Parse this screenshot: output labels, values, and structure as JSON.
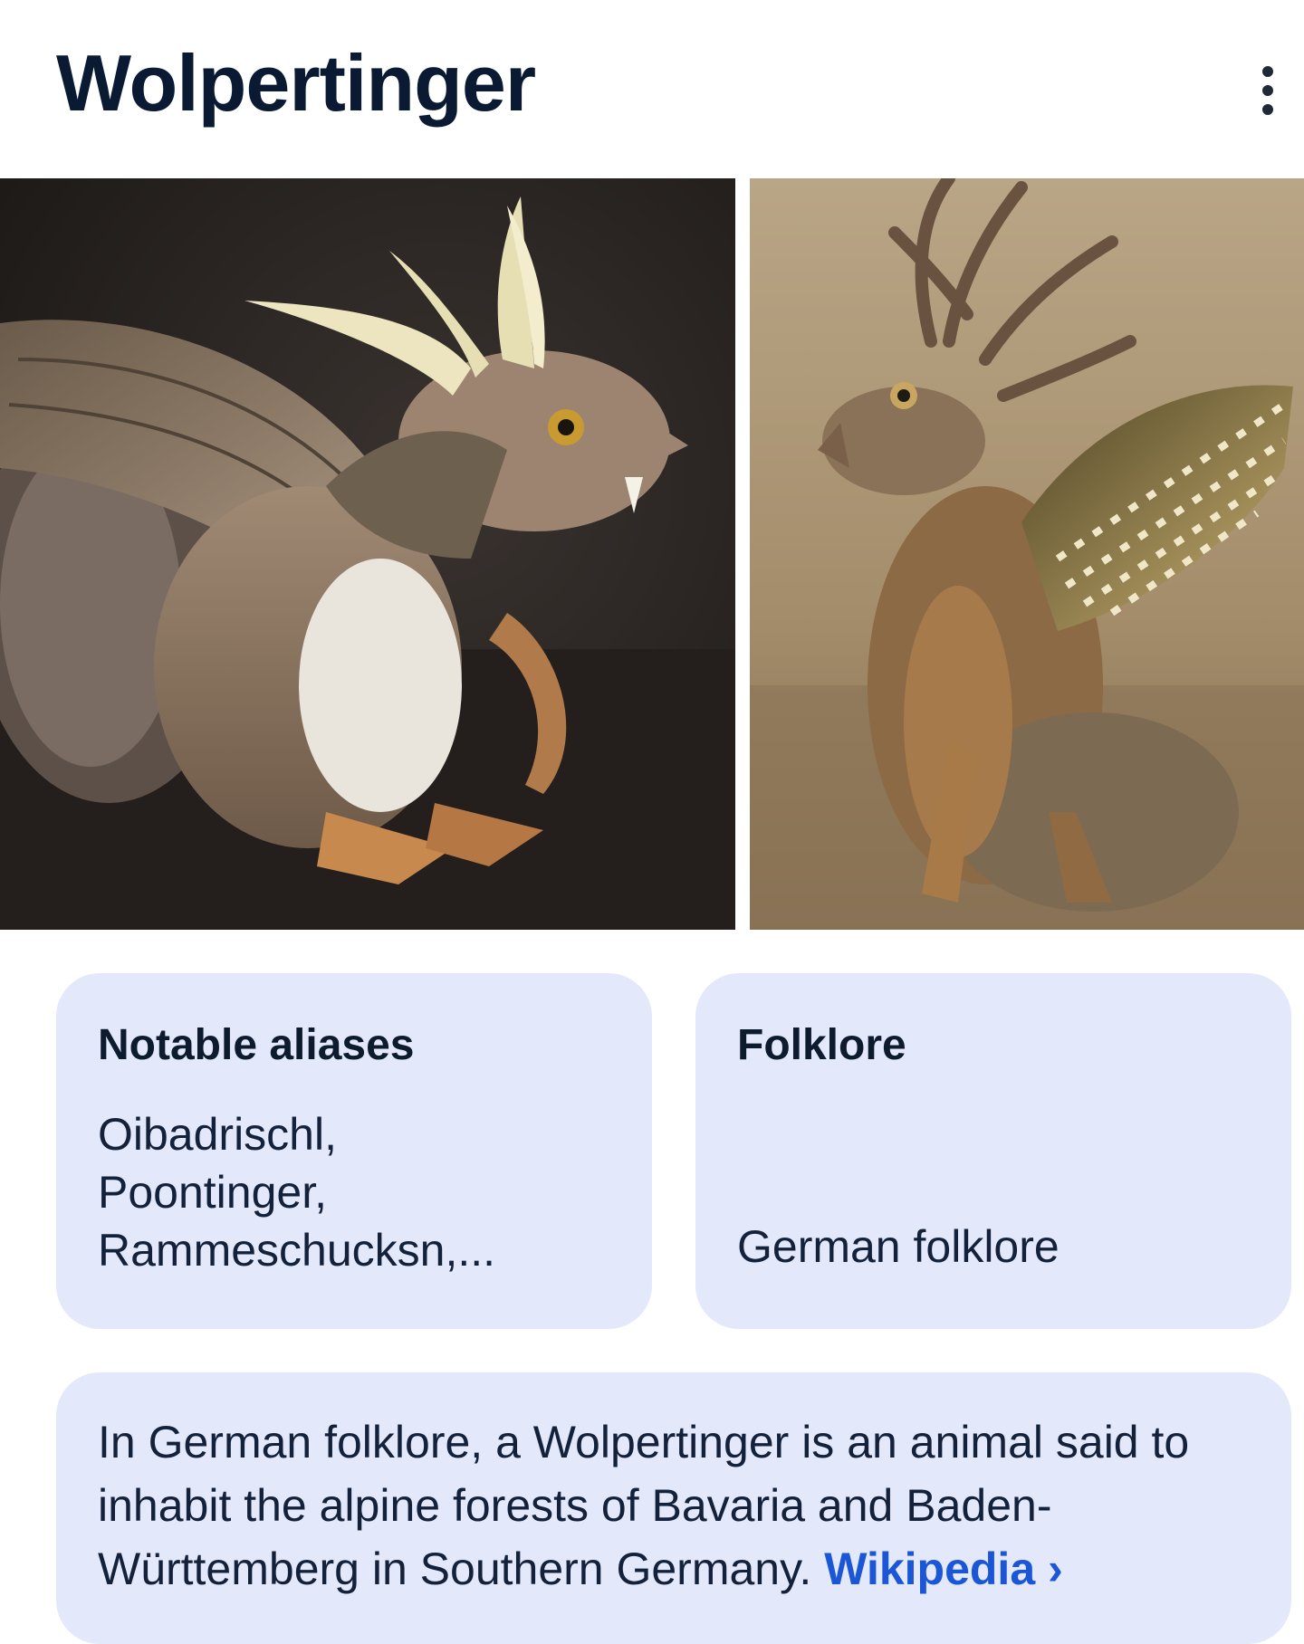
{
  "header": {
    "title": "Wolpertinger",
    "menu_icon": "more-vert-icon"
  },
  "images": [
    {
      "name": "image-wolpertinger-squirrel",
      "colors": {
        "bg": "#231f1d",
        "fur": "#8a7462",
        "antler": "#e8e2b8",
        "wing": "#7a6a58"
      }
    },
    {
      "name": "image-wolpertinger-hare",
      "colors": {
        "bg": "#a8916f",
        "fur": "#8c6a45",
        "antler": "#6b5440",
        "wing": "#6d5a2e"
      }
    }
  ],
  "cards": {
    "aliases": {
      "label": "Notable aliases",
      "value_lines": [
        "Oibadrischl,",
        "Poontinger,",
        "Rammeschucksn,..."
      ]
    },
    "folklore": {
      "label": "Folklore",
      "value": "German folklore"
    }
  },
  "description": {
    "text": "In German folklore, a Wolpertinger is an animal said to inhabit the alpine forests of Bavaria and Baden-Württemberg in Southern Germany. ",
    "link_label": "Wikipedia",
    "link_icon": "chevron-right-icon"
  },
  "colors": {
    "card_bg": "#e3e9fb",
    "link": "#1a56d6",
    "title": "#0a1a33"
  }
}
